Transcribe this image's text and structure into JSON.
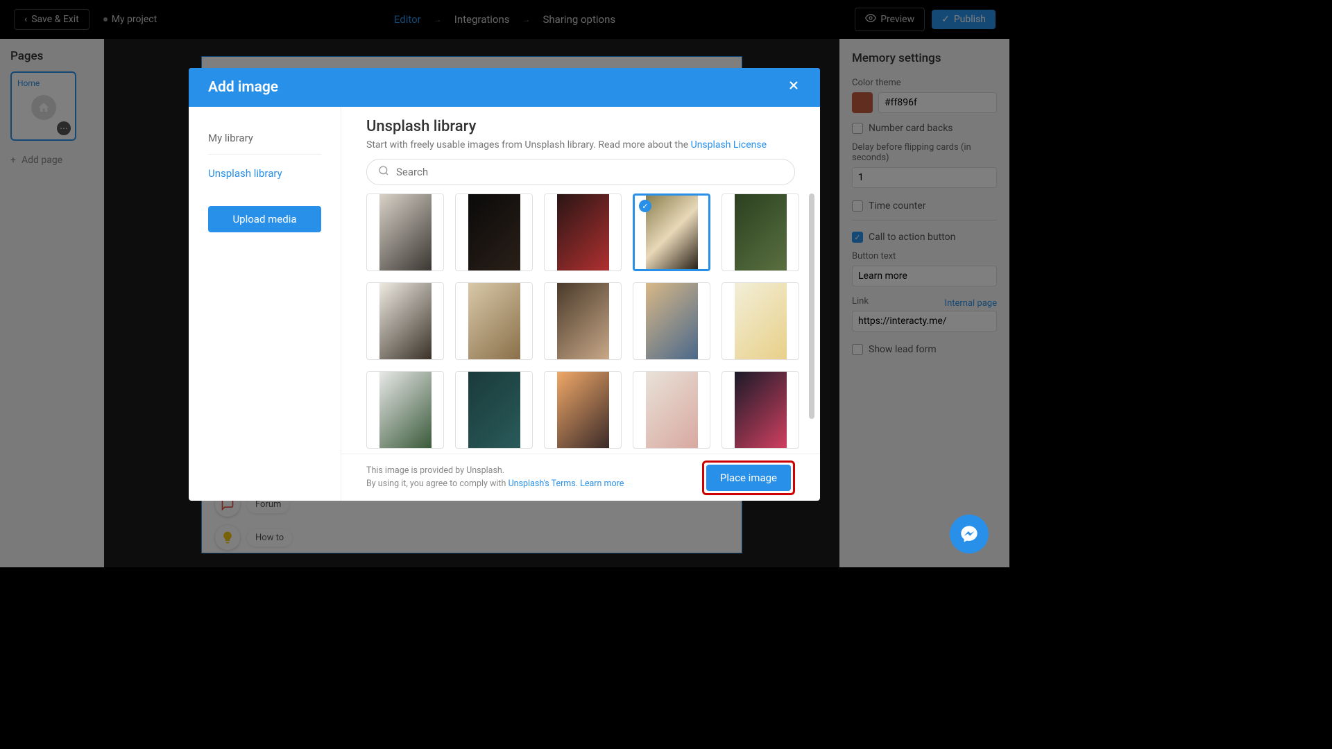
{
  "topbar": {
    "save_exit": "Save & Exit",
    "project": "My project",
    "tabs": {
      "editor": "Editor",
      "integrations": "Integrations",
      "sharing": "Sharing options"
    },
    "preview": "Preview",
    "publish": "Publish"
  },
  "left": {
    "title": "Pages",
    "page1": "Home",
    "add": "Add page"
  },
  "right": {
    "title": "Memory settings",
    "color_theme_label": "Color theme",
    "color_value": "#ff896f",
    "number_cards": "Number card backs",
    "delay_label": "Delay before flipping cards (in seconds)",
    "delay_value": "1",
    "time_counter": "Time counter",
    "cta": "Call to action button",
    "btn_text_label": "Button text",
    "btn_text_value": "Learn more",
    "link_label": "Link",
    "internal_page": "Internal page",
    "link_value": "https://interacty.me/",
    "show_lead": "Show lead form"
  },
  "help": {
    "forum": "Forum",
    "howto": "How to"
  },
  "modal": {
    "title": "Add image",
    "sidebar": {
      "my_library": "My library",
      "unsplash": "Unsplash library",
      "upload": "Upload media"
    },
    "main": {
      "title": "Unsplash library",
      "subtitle_1": "Start with freely usable images from Unsplash library. Read more about the ",
      "subtitle_link": "Unsplash License",
      "search_placeholder": "Search"
    },
    "footer": {
      "line1": "This image is provided by Unsplash.",
      "line2a": "By using it, you agree to comply with ",
      "terms": "Unsplash's Terms",
      "sep": ". ",
      "learn": "Learn more",
      "place": "Place image"
    }
  },
  "thumbs": [
    {
      "colors": [
        "#d8d2c8",
        "#3a3631"
      ],
      "selected": false
    },
    {
      "colors": [
        "#0a0a0a",
        "#2a1f18"
      ],
      "selected": false
    },
    {
      "colors": [
        "#2a1515",
        "#b03030"
      ],
      "selected": false
    },
    {
      "colors": [
        "#8a8050",
        "#e8d8b8",
        "#2a2218"
      ],
      "selected": true
    },
    {
      "colors": [
        "#2a4020",
        "#5a7040"
      ],
      "selected": false
    },
    {
      "colors": [
        "#eeeae2",
        "#3a3228"
      ],
      "selected": false
    },
    {
      "colors": [
        "#d8c8a8",
        "#8a704a"
      ],
      "selected": false
    },
    {
      "colors": [
        "#4a3a2a",
        "#c8a888"
      ],
      "selected": false
    },
    {
      "colors": [
        "#d8b888",
        "#4a688a"
      ],
      "selected": false
    },
    {
      "colors": [
        "#f2eed8",
        "#e8d088"
      ],
      "selected": false
    },
    {
      "colors": [
        "#e8e8e8",
        "#3a5a3a"
      ],
      "selected": false
    },
    {
      "colors": [
        "#1a3a3a",
        "#2a5a5a"
      ],
      "selected": false
    },
    {
      "colors": [
        "#f0a868",
        "#3a2a28"
      ],
      "selected": false
    },
    {
      "colors": [
        "#e8e2d8",
        "#d8a8a0"
      ],
      "selected": false
    },
    {
      "colors": [
        "#1a1a28",
        "#d04060"
      ],
      "selected": false
    }
  ]
}
